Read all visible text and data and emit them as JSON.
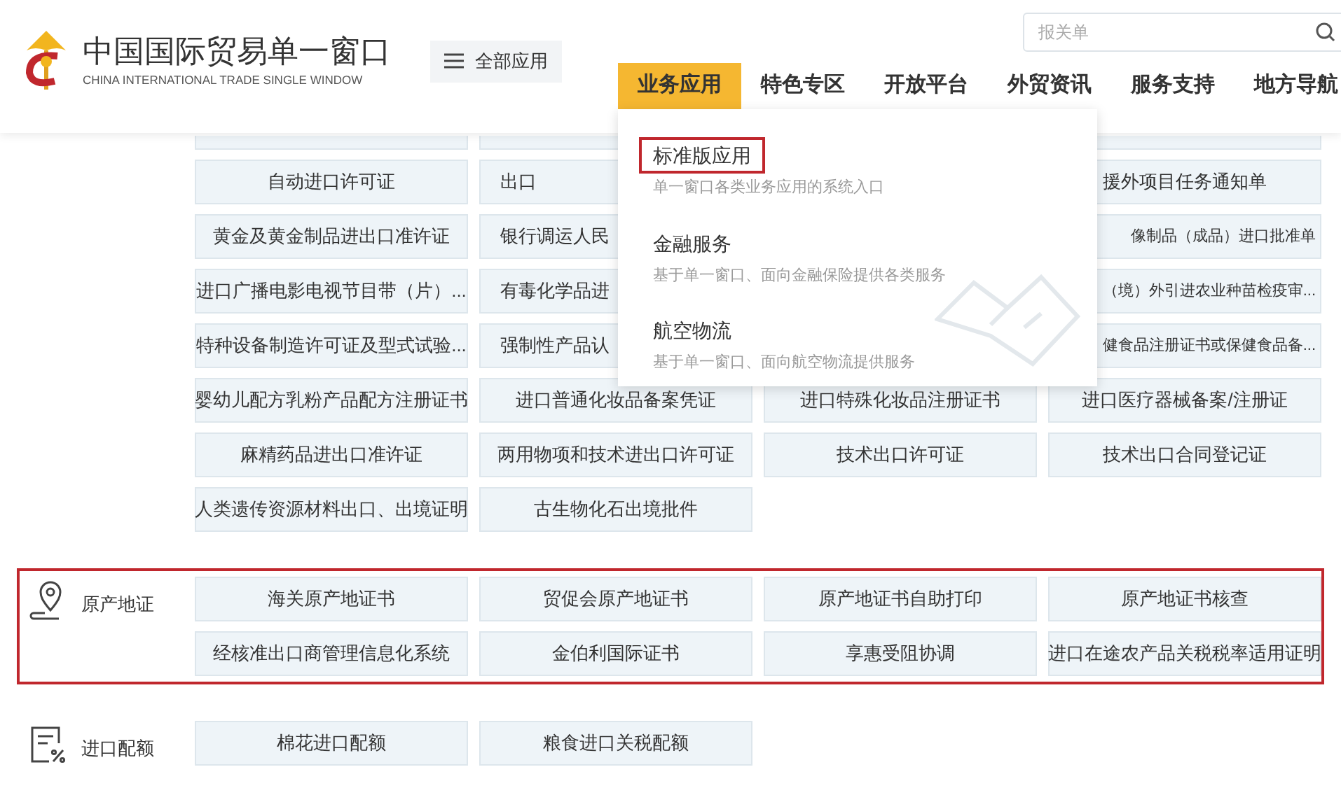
{
  "header": {
    "title": "中国国际贸易单一窗口",
    "subtitle": "CHINA INTERNATIONAL TRADE SINGLE WINDOW",
    "menu_button": "全部应用",
    "search": {
      "placeholder": "报关单"
    },
    "nav": [
      {
        "label": "业务应用",
        "selected": true
      },
      {
        "label": "特色专区",
        "selected": false
      },
      {
        "label": "开放平台",
        "selected": false
      },
      {
        "label": "外贸资讯",
        "selected": false
      },
      {
        "label": "服务支持",
        "selected": false
      },
      {
        "label": "地方导航",
        "selected": false
      }
    ]
  },
  "dropdown": [
    {
      "title": "标准版应用",
      "description": "单一窗口各类业务应用的系统入口",
      "highlighted": true
    },
    {
      "title": "金融服务",
      "description": "基于单一窗口、面向金融保险提供各类服务",
      "highlighted": false
    },
    {
      "title": "航空物流",
      "description": "基于单一窗口、面向航空物流提供服务",
      "highlighted": false
    }
  ],
  "sections": [
    {
      "kind": "plain",
      "highlighted": false,
      "partial_top": true,
      "tiles": [
        {
          "label": "自动进口许可证",
          "kind": "full"
        },
        {
          "label": "出口",
          "kind": "cut_right"
        },
        {
          "kind": "hidden"
        },
        {
          "label": "援外项目任务通知单",
          "kind": "full"
        },
        {
          "label": "黄金及黄金制品进出口准许证",
          "kind": "full"
        },
        {
          "label": "银行调运人民",
          "kind": "cut_right"
        },
        {
          "kind": "hidden"
        },
        {
          "label": "像制品（成品）进口批准单",
          "kind": "cut_left"
        },
        {
          "label": "进口广播电影电视节目带（片）...",
          "kind": "full"
        },
        {
          "label": "有毒化学品进",
          "kind": "cut_right"
        },
        {
          "kind": "hidden"
        },
        {
          "label": "（境）外引进农业种苗检疫审...",
          "kind": "cut_left"
        },
        {
          "label": "特种设备制造许可证及型式试验...",
          "kind": "full"
        },
        {
          "label": "强制性产品认",
          "kind": "cut_right"
        },
        {
          "kind": "hidden"
        },
        {
          "label": "健食品注册证书或保健食品备...",
          "kind": "cut_left"
        },
        {
          "label": "婴幼儿配方乳粉产品配方注册证书",
          "kind": "full"
        },
        {
          "label": "进口普通化妆品备案凭证",
          "kind": "full"
        },
        {
          "label": "进口特殊化妆品注册证书",
          "kind": "full"
        },
        {
          "label": "进口医疗器械备案/注册证",
          "kind": "full"
        },
        {
          "label": "麻精药品进出口准许证",
          "kind": "full"
        },
        {
          "label": "两用物项和技术进出口许可证",
          "kind": "full"
        },
        {
          "label": "技术出口许可证",
          "kind": "full"
        },
        {
          "label": "技术出口合同登记证",
          "kind": "full"
        },
        {
          "label": "人类遗传资源材料出口、出境证明",
          "kind": "full"
        },
        {
          "label": "古生物化石出境批件",
          "kind": "full"
        }
      ]
    },
    {
      "kind": "origin",
      "label": "原产地证",
      "highlighted": true,
      "partial_top": false,
      "tiles": [
        {
          "label": "海关原产地证书",
          "kind": "full"
        },
        {
          "label": "贸促会原产地证书",
          "kind": "full"
        },
        {
          "label": "原产地证书自助打印",
          "kind": "full"
        },
        {
          "label": "原产地证书核查",
          "kind": "full"
        },
        {
          "label": "经核准出口商管理信息化系统",
          "kind": "full"
        },
        {
          "label": "金伯利国际证书",
          "kind": "full"
        },
        {
          "label": "享惠受阻协调",
          "kind": "full"
        },
        {
          "label": "进口在途农产品关税税率适用证明",
          "kind": "full"
        }
      ]
    },
    {
      "kind": "quota",
      "label": "进口配额",
      "highlighted": false,
      "partial_top": false,
      "tiles": [
        {
          "label": "棉花进口配额",
          "kind": "full"
        },
        {
          "label": "粮食进口关税配额",
          "kind": "full"
        }
      ]
    }
  ]
}
